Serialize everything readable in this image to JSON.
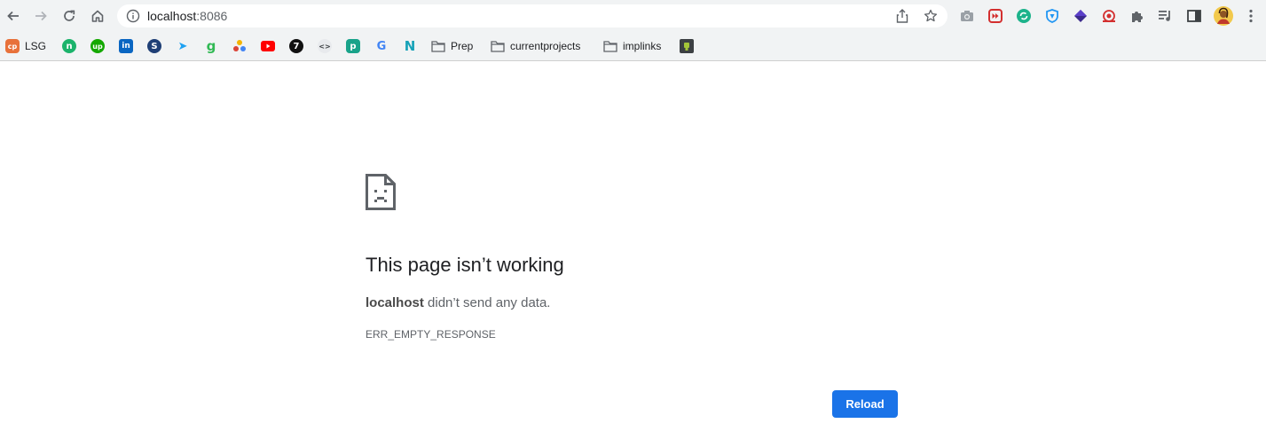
{
  "browser": {
    "address": {
      "host": "localhost",
      "port": ":8086"
    },
    "nav": [
      "back-icon",
      "forward-icon",
      "reload-icon",
      "home-icon"
    ],
    "omnibox_icons": [
      "share-icon",
      "bookmark-star-icon"
    ],
    "extensions": [
      "camera-icon",
      "media-ext-icon",
      "refresh-ext-icon",
      "vpn-shield-icon",
      "dark-gem-icon",
      "target-ext-icon",
      "puzzle-icon",
      "media-queue-icon",
      "sidepanel-icon",
      "avatar",
      "menu-icon"
    ]
  },
  "bookmarks": [
    {
      "label": "LSG",
      "color": "#e8713a",
      "glyph": "cp"
    },
    {
      "label": "",
      "color": "#1bb36b",
      "glyph": "n"
    },
    {
      "label": "",
      "color": "#14a800",
      "glyph": "up"
    },
    {
      "label": "",
      "color": "#0a66c2",
      "glyph": "in"
    },
    {
      "label": "",
      "color": "#1f3f76",
      "glyph": "S"
    },
    {
      "label": "",
      "color": "#1da1f2",
      "glyph": "➤"
    },
    {
      "label": "",
      "color": "#31b954",
      "glyph": "g"
    },
    {
      "label": "",
      "color": "#f4b400",
      "glyph": "•"
    },
    {
      "label": "",
      "color": "#ff0000",
      "glyph": "▶"
    },
    {
      "label": "",
      "color": "#111111",
      "glyph": "7"
    },
    {
      "label": "",
      "color": "#e8eaed",
      "glyph": "<>"
    },
    {
      "label": "",
      "color": "#19a38a",
      "glyph": "p"
    },
    {
      "label": "",
      "color": "#4285f4",
      "glyph": "G"
    },
    {
      "label": "",
      "color": "#17a2b8",
      "glyph": "N"
    },
    {
      "label": "Prep",
      "folder": true
    },
    {
      "label": "currentprojects",
      "folder": true
    },
    {
      "label": "implinks",
      "folder": true
    },
    {
      "label": "",
      "color": "#3c4043",
      "glyph": "▮"
    }
  ],
  "error": {
    "title": "This page isn’t working",
    "host": "localhost",
    "message": " didn’t send any data.",
    "code": "ERR_EMPTY_RESPONSE",
    "reload_label": "Reload"
  }
}
